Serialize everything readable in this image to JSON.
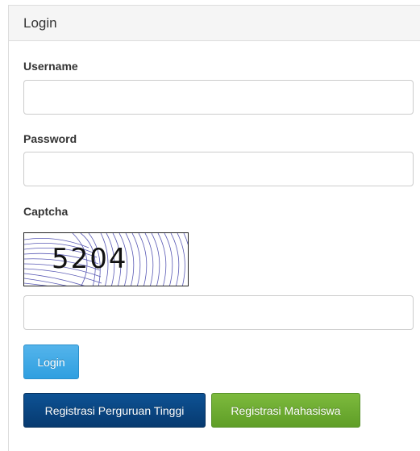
{
  "panel": {
    "title": "Login"
  },
  "form": {
    "username_label": "Username",
    "username_value": "",
    "password_label": "Password",
    "password_value": "",
    "captcha_label": "Captcha",
    "captcha_image_text": "5204",
    "captcha_value": ""
  },
  "buttons": {
    "login": "Login",
    "register_institution": "Registrasi Perguruan Tinggi",
    "register_student": "Registrasi Mahasiswa"
  },
  "colors": {
    "login_button": "#3aa8e6",
    "institution_button": "#0a4682",
    "student_button": "#6aac31"
  }
}
